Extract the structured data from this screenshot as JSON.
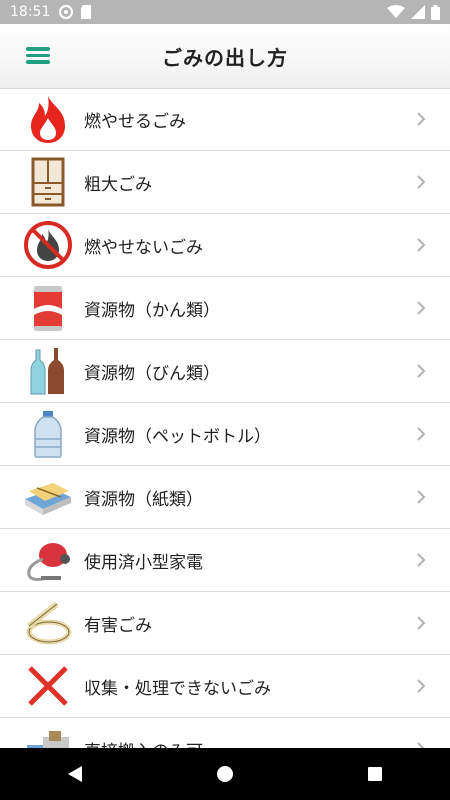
{
  "status": {
    "time": "18:51"
  },
  "header": {
    "title": "ごみの出し方"
  },
  "items": [
    {
      "label": "燃やせるごみ",
      "icon": "fire-icon"
    },
    {
      "label": "粗大ごみ",
      "icon": "cabinet-icon"
    },
    {
      "label": "燃やせないごみ",
      "icon": "no-burn-icon"
    },
    {
      "label": "資源物（かん類）",
      "icon": "can-icon"
    },
    {
      "label": "資源物（びん類）",
      "icon": "bottles-icon"
    },
    {
      "label": "資源物（ペットボトル）",
      "icon": "pet-bottle-icon"
    },
    {
      "label": "資源物（紙類）",
      "icon": "newspaper-icon"
    },
    {
      "label": "使用済小型家電",
      "icon": "vacuum-cleaner-icon"
    },
    {
      "label": "有害ごみ",
      "icon": "fluorescent-lamp-icon"
    },
    {
      "label": "収集・処理できないごみ",
      "icon": "cross-icon"
    },
    {
      "label": "直接搬入のみ可",
      "icon": "truck-icon"
    }
  ],
  "colors": {
    "accent": "#1f9f7f",
    "status_bar": "#b5b5b5"
  }
}
